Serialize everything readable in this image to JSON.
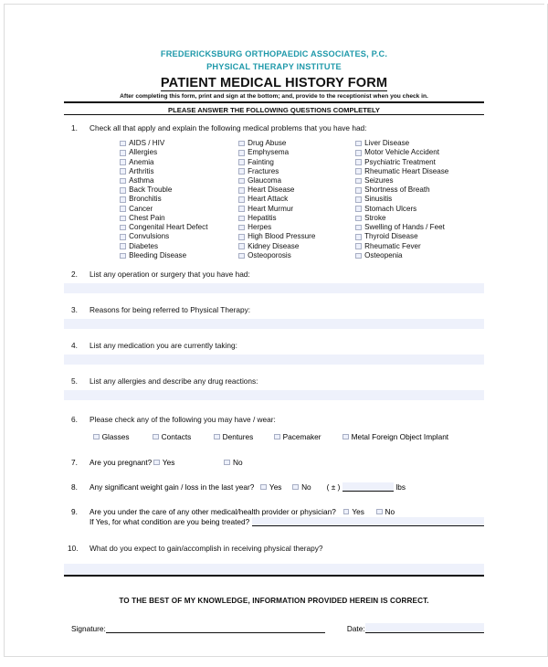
{
  "header": {
    "org_line1": "FREDERICKSBURG ORTHOPAEDIC ASSOCIATES, P.C.",
    "org_line2": "PHYSICAL THERAPY INSTITUTE",
    "title": "PATIENT MEDICAL HISTORY FORM",
    "subtitle": "After completing this form, print and sign at the bottom; and, provide to the receptionist when you check in.",
    "instruction": "PLEASE ANSWER THE FOLLOWING QUESTIONS COMPLETELY",
    "accent_color": "#1f99aa"
  },
  "q1": {
    "number": "1.",
    "prompt": "Check all that apply and explain the following medical problems that you have had:",
    "column1": [
      "AIDS / HIV",
      "Allergies",
      "Anemia",
      "Arthritis",
      "Asthma",
      "Back Trouble",
      "Bronchitis",
      "Cancer",
      "Chest Pain",
      "Congenital Heart Defect",
      "Convulsions",
      "Diabetes",
      "Bleeding Disease"
    ],
    "column2": [
      "Drug Abuse",
      "Emphysema",
      "Fainting",
      "Fractures",
      "Glaucoma",
      "Heart Disease",
      "Heart Attack",
      "Heart Murmur",
      "Hepatitis",
      "Herpes",
      "High Blood Pressure",
      "Kidney Disease",
      "Osteoporosis"
    ],
    "column3": [
      "Liver Disease",
      "Motor Vehicle Accident",
      "Psychiatric Treatment",
      "Rheumatic Heart Disease",
      "Seizures",
      "Shortness of Breath",
      "Sinusitis",
      "Stomach Ulcers",
      "Stroke",
      "Swelling of Hands / Feet",
      "Thyroid Disease",
      "Rheumatic Fever",
      "Osteopenia"
    ]
  },
  "q2": {
    "number": "2.",
    "prompt": "List any operation or surgery that you have had:",
    "answer": ""
  },
  "q3": {
    "number": "3.",
    "prompt": "Reasons for being referred to Physical Therapy:",
    "answer": ""
  },
  "q4": {
    "number": "4.",
    "prompt": "List any medication you are currently taking:",
    "answer": ""
  },
  "q5": {
    "number": "5.",
    "prompt": "List any allergies and describe any drug reactions:",
    "answer": ""
  },
  "q6": {
    "number": "6.",
    "prompt": "Please check any of the following you may have / wear:",
    "options": [
      "Glasses",
      "Contacts",
      "Dentures",
      "Pacemaker",
      "Metal Foreign Object Implant"
    ]
  },
  "q7": {
    "number": "7.",
    "prompt": "Are you pregnant?",
    "yes_label": "Yes",
    "no_label": "No"
  },
  "q8": {
    "number": "8.",
    "prompt": "Any significant weight gain / loss in the last year?",
    "yes_label": "Yes",
    "no_label": "No",
    "amount_prefix": "( ± )",
    "amount_value": "",
    "amount_unit": "lbs"
  },
  "q9": {
    "number": "9.",
    "prompt": "Are you under the care of any other medical/health provider or physician?",
    "yes_label": "Yes",
    "no_label": "No",
    "followup": "If Yes, for what condition are you being treated?",
    "followup_answer": ""
  },
  "q10": {
    "number": "10.",
    "prompt": "What do you expect to gain/accomplish in receiving physical therapy?",
    "answer": ""
  },
  "attestation": "TO THE BEST OF MY KNOWLEDGE, INFORMATION PROVIDED HEREIN IS CORRECT.",
  "signature": {
    "signature_label": "Signature:",
    "signature_value": "",
    "date_label": "Date:",
    "date_value": ""
  }
}
